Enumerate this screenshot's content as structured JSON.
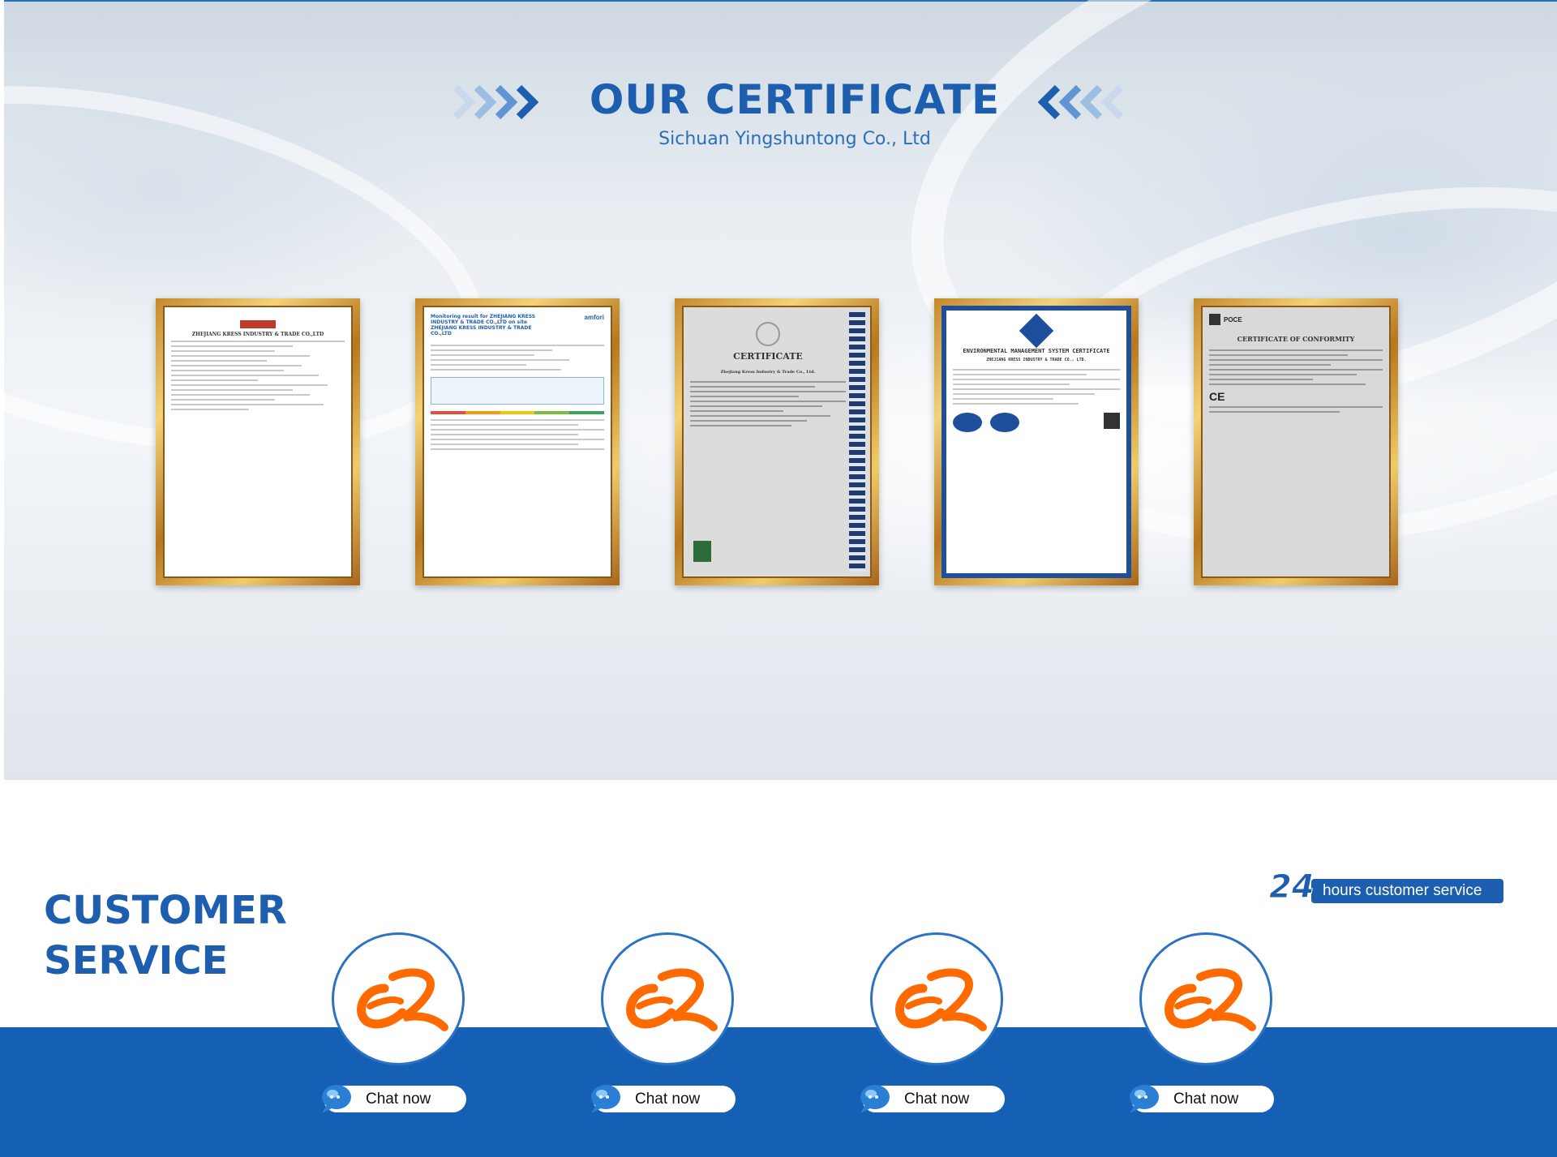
{
  "certificates": {
    "title": "OUR CERTIFICATE",
    "subtitle": "Sichuan Yingshuntong Co., Ltd",
    "items": [
      {
        "heading": "ZHEJIANG KRESS INDUSTRY & TRADE CO.,LTD"
      },
      {
        "heading": "Monitoring result for ZHEJIANG KRESS INDUSTRY & TRADE CO.,LTD on site ZHEJIANG KRESS INDUSTRY & TRADE CO.,LTD",
        "brand": "amfori"
      },
      {
        "heading": "CERTIFICATE",
        "company": "Zhejiang Kress Industry & Trade Co., Ltd."
      },
      {
        "heading": "ENVIRONMENTAL MANAGEMENT SYSTEM CERTIFICATE",
        "company": "ZHEJIANG KRESS INDUSTRY & TRADE CO., LTD."
      },
      {
        "heading": "CERTIFICATE OF CONFORMITY",
        "brand": "POCE"
      }
    ]
  },
  "customer_service": {
    "title_line1": "CUSTOMER",
    "title_line2": "SERVICE",
    "badge_number": "24",
    "badge_text": "hours customer service",
    "agents": [
      {
        "button": "Chat now"
      },
      {
        "button": "Chat now"
      },
      {
        "button": "Chat now"
      },
      {
        "button": "Chat now"
      }
    ]
  },
  "colors": {
    "brand_blue": "#1d5fae",
    "band_blue": "#1560b5",
    "logo_orange": "#ff6a00",
    "frame_gold": "#d9a441"
  }
}
